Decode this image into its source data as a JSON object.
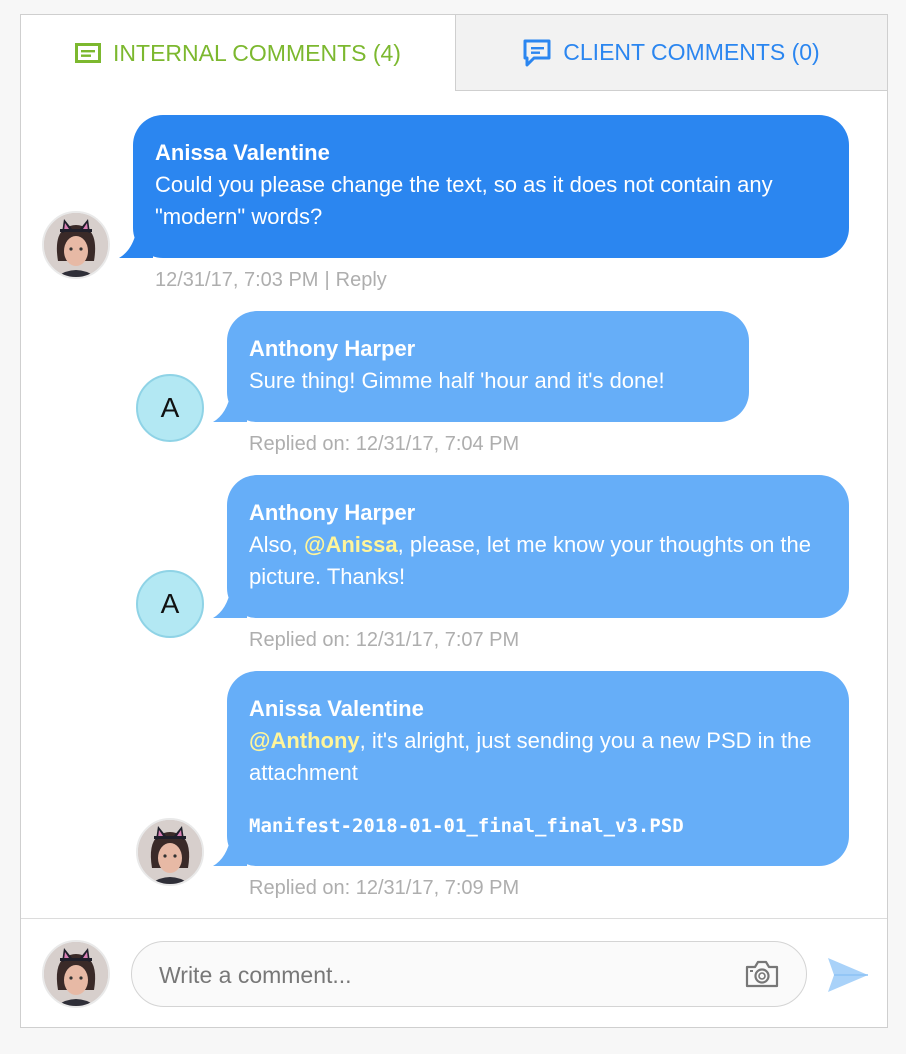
{
  "tabs": {
    "internal": {
      "label": "INTERNAL COMMENTS (4)",
      "color": "#7cb82f"
    },
    "client": {
      "label": "CLIENT COMMENTS (0)",
      "color": "#2b86f0"
    }
  },
  "comments": [
    {
      "author": "Anissa Valentine",
      "text": "Could you please change the text, so as it does not contain any \"modern\" words?",
      "timestamp": "12/31/17, 7:03 PM",
      "separator": "|",
      "reply_label": "Reply"
    },
    {
      "author": "Anthony Harper",
      "avatar_letter": "A",
      "text": "Sure thing! Gimme half 'hour and it's done!",
      "meta": "Replied on: 12/31/17, 7:04 PM"
    },
    {
      "author": "Anthony Harper",
      "avatar_letter": "A",
      "mention": "@Anissa",
      "text_after": ", please, let me know your thoughts on the picture. Thanks!",
      "text_before": "Also, ",
      "meta": "Replied on: 12/31/17, 7:07 PM"
    },
    {
      "author": "Anissa Valentine",
      "mention": "@Anthony",
      "text_after": ", it's alright, just sending you a new PSD in the attachment",
      "attachment": "Manifest-2018-01-01_final_final_v3.PSD",
      "meta": "Replied on: 12/31/17, 7:09 PM"
    }
  ],
  "composer": {
    "placeholder": "Write a comment...",
    "camera_icon": "camera-icon",
    "send_icon": "send-icon"
  },
  "colors": {
    "bubble_primary": "#2b86f0",
    "bubble_reply": "#66aef8",
    "mention": "#fff59a",
    "meta_text": "#aeaeae",
    "letter_avatar": "#b3e8f3"
  }
}
